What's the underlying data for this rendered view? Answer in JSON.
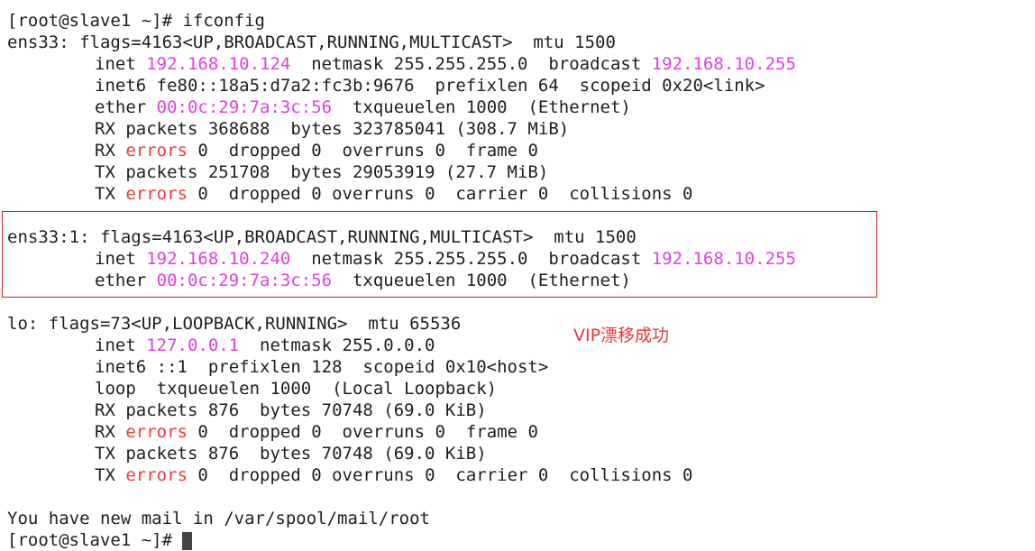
{
  "terminal": {
    "prompt_line": "[root@slave1 ~]# ifconfig",
    "ens33": {
      "header": "ens33: flags=4163<UP,BROADCAST,RUNNING,MULTICAST>  mtu 1500",
      "inet_label": "inet ",
      "inet_addr": "192.168.10.124",
      "netmask_text": "  netmask 255.255.255.0  broadcast ",
      "broadcast_addr": "192.168.10.255",
      "inet6_line": "inet6 fe80::18a5:d7a2:fc3b:9676  prefixlen 64  scopeid 0x20<link>",
      "ether_label": "ether ",
      "ether_addr": "00:0c:29:7a:3c:56",
      "ether_rest": "  txqueuelen 1000  (Ethernet)",
      "rx_packets": "RX packets 368688  bytes 323785041 (308.7 MiB)",
      "rx_err_label": "RX ",
      "rx_err_word": "errors",
      "rx_err_rest": " 0  dropped 0  overruns 0  frame 0",
      "tx_packets": "TX packets 251708  bytes 29053919 (27.7 MiB)",
      "tx_err_label": "TX ",
      "tx_err_word": "errors",
      "tx_err_rest": " 0  dropped 0 overruns 0  carrier 0  collisions 0"
    },
    "ens33_1": {
      "header": "ens33:1: flags=4163<UP,BROADCAST,RUNNING,MULTICAST>  mtu 1500",
      "inet_label": "inet ",
      "inet_addr": "192.168.10.240",
      "netmask_text": "  netmask 255.255.255.0  broadcast ",
      "broadcast_addr": "192.168.10.255",
      "ether_label": "ether ",
      "ether_addr": "00:0c:29:7a:3c:56",
      "ether_rest": "  txqueuelen 1000  (Ethernet)"
    },
    "lo": {
      "header": "lo: flags=73<UP,LOOPBACK,RUNNING>  mtu 65536",
      "inet_label": "inet ",
      "inet_addr": "127.0.0.1",
      "netmask_text": "  netmask 255.0.0.0",
      "inet6_line": "inet6 ::1  prefixlen 128  scopeid 0x10<host>",
      "loop_line": "loop  txqueuelen 1000  (Local Loopback)",
      "rx_packets": "RX packets 876  bytes 70748 (69.0 KiB)",
      "rx_err_label": "RX ",
      "rx_err_word": "errors",
      "rx_err_rest": " 0  dropped 0  overruns 0  frame 0",
      "tx_packets": "TX packets 876  bytes 70748 (69.0 KiB)",
      "tx_err_label": "TX ",
      "tx_err_word": "errors",
      "tx_err_rest": " 0  dropped 0 overruns 0  carrier 0  collisions 0"
    },
    "mail_line": "You have new mail in /var/spool/mail/root",
    "last_prompt": "[root@slave1 ~]# "
  },
  "annotation": {
    "text": "VIP漂移成功",
    "color": "#e53935"
  },
  "colors": {
    "address": "#e040e0",
    "error_word": "#ef3b3b",
    "highlight_border": "#d81e1e"
  }
}
